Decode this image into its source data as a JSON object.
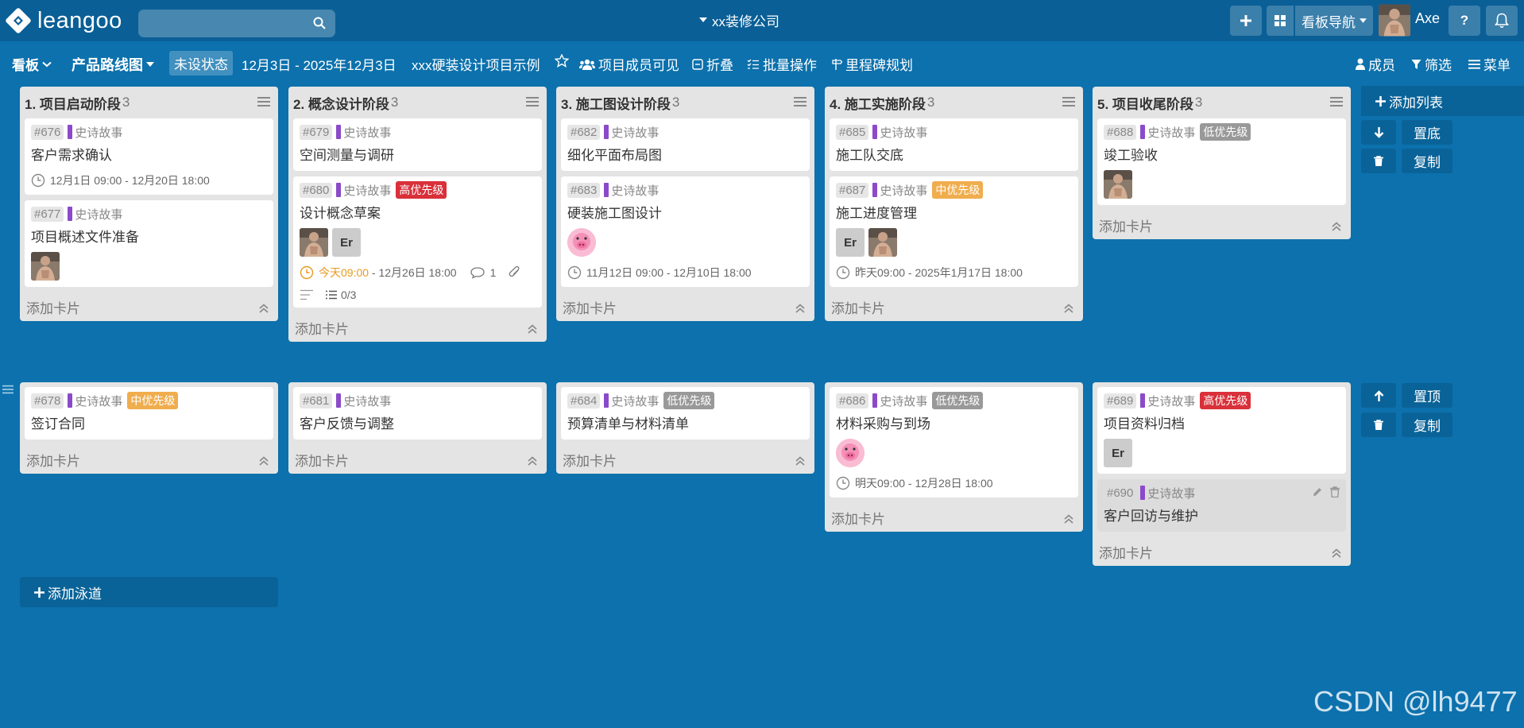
{
  "topbar": {
    "brand": "leangoo",
    "search_placeholder": "",
    "company": "xx装修公司",
    "board_nav_label": "看板导航",
    "user_name": "Axe",
    "help_label": "?"
  },
  "secbar": {
    "board_label": "看板",
    "roadmap_label": "产品路线图",
    "status_label": "未设状态",
    "date_range": "12月3日 - 2025年12月3日",
    "project_name": "xxx硬装设计项目示例",
    "visibility_label": "项目成员可见",
    "fold_label": "折叠",
    "batch_label": "批量操作",
    "milestone_label": "里程碑规划",
    "members_label": "成员",
    "filter_label": "筛选",
    "menu_label": "菜单"
  },
  "common": {
    "epic_label": "史诗故事",
    "add_card": "添加卡片"
  },
  "lists": [
    {
      "title": "1. 项目启动阶段",
      "count": "3"
    },
    {
      "title": "2. 概念设计阶段",
      "count": "3"
    },
    {
      "title": "3. 施工图设计阶段",
      "count": "3"
    },
    {
      "title": "4. 施工实施阶段",
      "count": "3"
    },
    {
      "title": "5. 项目收尾阶段",
      "count": "3"
    }
  ],
  "cards": {
    "c676": {
      "num": "#676",
      "title": "客户需求确认",
      "date": "12月1日 09:00 - 12月20日 18:00"
    },
    "c677": {
      "num": "#677",
      "title": "项目概述文件准备"
    },
    "c678": {
      "num": "#678",
      "title": "签订合同",
      "priority": "中优先级"
    },
    "c679": {
      "num": "#679",
      "title": "空间测量与调研"
    },
    "c680": {
      "num": "#680",
      "title": "设计概念草案",
      "priority": "高优先级",
      "date_highlight": "今天09:00",
      "date_rest": " - 12月26日 18:00",
      "comments": "1",
      "checklist": "0/3",
      "avatar_initials": "Er"
    },
    "c681": {
      "num": "#681",
      "title": "客户反馈与调整"
    },
    "c682": {
      "num": "#682",
      "title": "细化平面布局图"
    },
    "c683": {
      "num": "#683",
      "title": "硬装施工图设计",
      "date": "11月12日 09:00 - 12月10日 18:00"
    },
    "c684": {
      "num": "#684",
      "title": "预算清单与材料清单",
      "priority": "低优先级"
    },
    "c685": {
      "num": "#685",
      "title": "施工队交底"
    },
    "c687": {
      "num": "#687",
      "title": "施工进度管理",
      "priority": "中优先级",
      "date": "昨天09:00 - 2025年1月17日 18:00",
      "avatar_initials": "Er"
    },
    "c686": {
      "num": "#686",
      "title": "材料采购与到场",
      "priority": "低优先级",
      "date": "明天09:00 - 12月28日 18:00"
    },
    "c688": {
      "num": "#688",
      "title": "竣工验收",
      "priority": "低优先级"
    },
    "c689": {
      "num": "#689",
      "title": "项目资料归档",
      "priority": "高优先级",
      "avatar_initials": "Er"
    },
    "c690": {
      "num": "#690",
      "title": "客户回访与维护"
    }
  },
  "side": {
    "add_list": "添加列表",
    "bottom": "置底",
    "top": "置顶",
    "copy": "复制",
    "add_lane": "添加泳道"
  },
  "priority_colors": {
    "高优先级": "#d9303a",
    "中优先级": "#f0ad4e",
    "低优先级": "#999999"
  },
  "epic_color": "#8b4ac9",
  "watermark": "CSDN @lh9477"
}
